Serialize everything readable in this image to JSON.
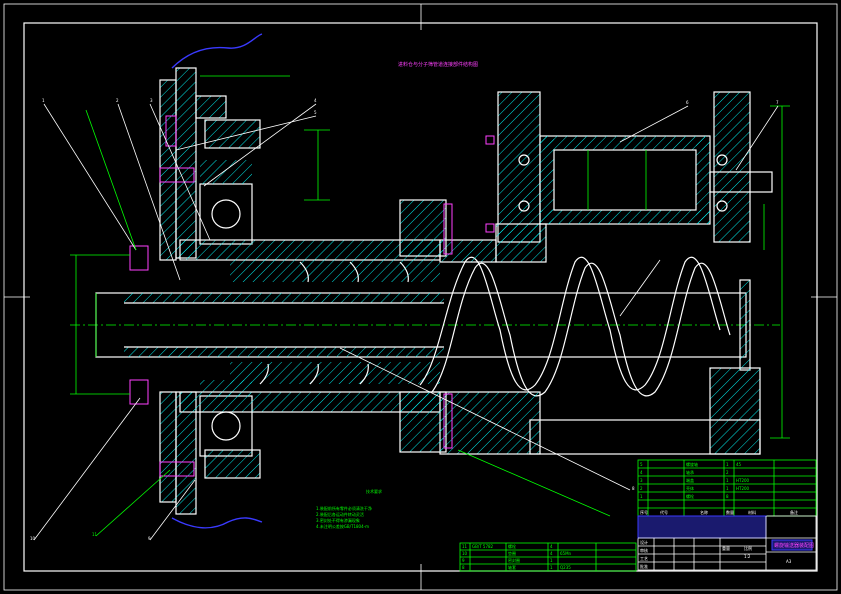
{
  "drawing": {
    "title_note": "进料仓与分子筛管道连接部件结构图",
    "small_note": "技术要求",
    "notes_lines": [
      "1.装配前所有零件必须清洗干净",
      "2.装配后各运动件转动灵活",
      "3.密封处不得有渗漏现象",
      "4.未注明公差按GB/T1804-m"
    ],
    "part_callouts": [
      "1",
      "2",
      "3",
      "4",
      "5",
      "6",
      "7",
      "8",
      "9",
      "10",
      "11"
    ],
    "parts_list": {
      "headers": [
        "序号",
        "代号",
        "名称",
        "数量",
        "材料",
        "备注"
      ],
      "rows": [
        [
          "5",
          "",
          "螺旋轴",
          "1",
          "45",
          ""
        ],
        [
          "4",
          "",
          "轴承",
          "2",
          "",
          ""
        ],
        [
          "3",
          "",
          "端盖",
          "1",
          "HT200",
          ""
        ],
        [
          "2",
          "",
          "壳体",
          "1",
          "HT200",
          ""
        ],
        [
          "1",
          "",
          "螺栓",
          "8",
          "",
          ""
        ]
      ]
    },
    "title_block": {
      "name": "螺旋输送器装配图",
      "scale": "1:2",
      "sheet": "A3",
      "labels": [
        "设计",
        "审核",
        "工艺",
        "批准"
      ],
      "weight_label": "重量",
      "scale_label": "比例"
    },
    "left_table": {
      "rows": [
        [
          "11",
          "GB/T 5782",
          "螺栓",
          "4",
          "",
          ""
        ],
        [
          "10",
          "",
          "垫圈",
          "4",
          "65Mn",
          ""
        ],
        [
          "9",
          "",
          "密封圈",
          "1",
          "",
          ""
        ],
        [
          "8",
          "",
          "轴套",
          "1",
          "Q235",
          ""
        ]
      ]
    },
    "colors": {
      "background": "#000000",
      "outline": "#ffffff",
      "hatch": "#00ffff",
      "dimension": "#00ff00",
      "bolt": "#ff40ff",
      "hidden": "#3a3aff"
    }
  }
}
